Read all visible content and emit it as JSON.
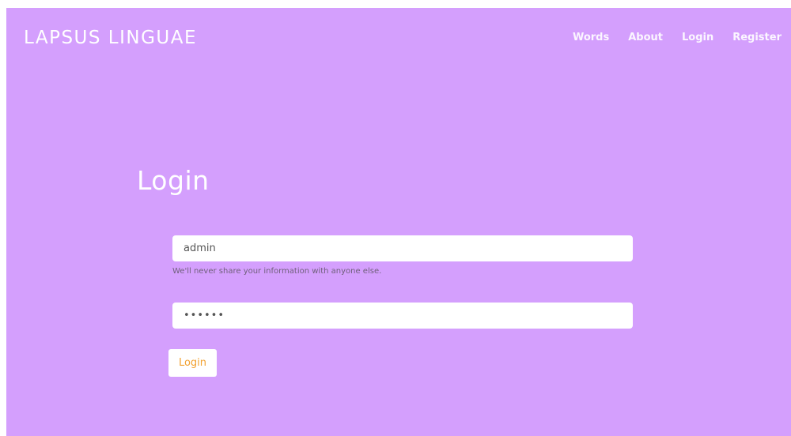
{
  "brand": {
    "name": "LAPSUS LINGUAE"
  },
  "nav": {
    "words": "Words",
    "about": "About",
    "login": "Login",
    "register": "Register"
  },
  "page": {
    "title": "Login"
  },
  "form": {
    "username_value": "admin",
    "help_text": "We'll never share your information with anyone else.",
    "password_value": "••••••",
    "submit_label": "Login"
  },
  "colors": {
    "background": "#d49ffd",
    "button_text": "#f2a232",
    "text_light": "#ffffff"
  }
}
